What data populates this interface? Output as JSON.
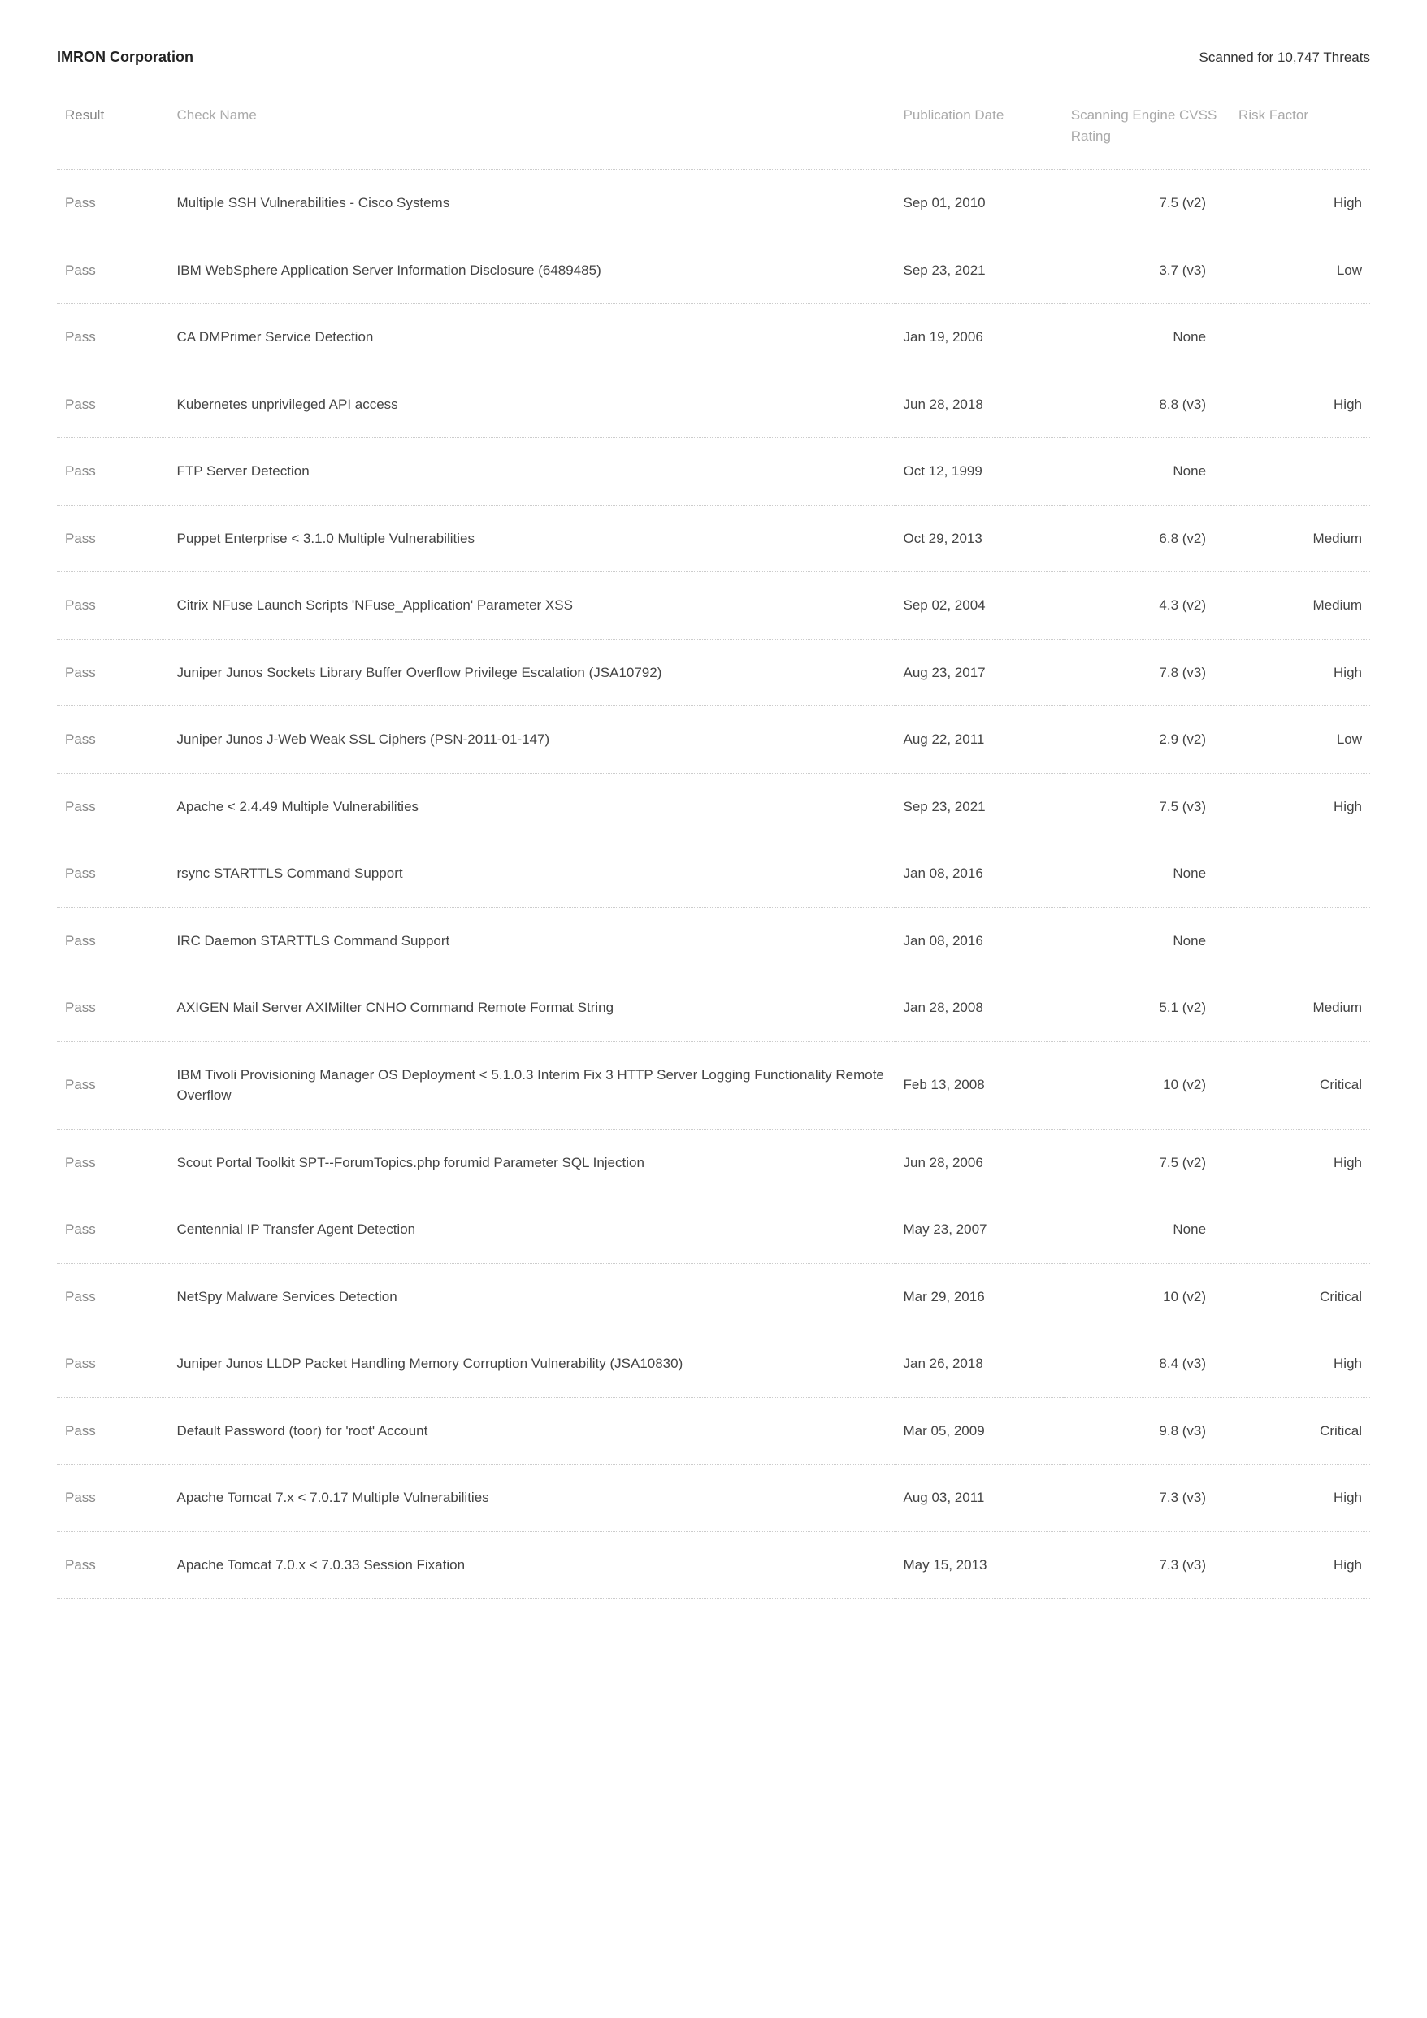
{
  "header": {
    "company": "IMRON Corporation",
    "scan_summary": "Scanned for 10,747 Threats"
  },
  "columns": {
    "result": "Result",
    "check_name": "Check Name",
    "pub_date": "Publication Date",
    "cvss": "Scanning Engine CVSS Rating",
    "risk": "Risk Factor"
  },
  "rows": [
    {
      "result": "Pass",
      "name": "Multiple SSH Vulnerabilities - Cisco Systems",
      "date": "Sep 01, 2010",
      "cvss": "7.5 (v2)",
      "risk": "High"
    },
    {
      "result": "Pass",
      "name": "IBM WebSphere Application Server Information Disclosure (6489485)",
      "date": "Sep 23, 2021",
      "cvss": "3.7 (v3)",
      "risk": "Low"
    },
    {
      "result": "Pass",
      "name": "CA DMPrimer Service Detection",
      "date": "Jan 19, 2006",
      "cvss": "None",
      "risk": ""
    },
    {
      "result": "Pass",
      "name": "Kubernetes unprivileged API access",
      "date": "Jun 28, 2018",
      "cvss": "8.8 (v3)",
      "risk": "High"
    },
    {
      "result": "Pass",
      "name": "FTP Server Detection",
      "date": "Oct 12, 1999",
      "cvss": "None",
      "risk": ""
    },
    {
      "result": "Pass",
      "name": "Puppet Enterprise < 3.1.0 Multiple Vulnerabilities",
      "date": "Oct 29, 2013",
      "cvss": "6.8 (v2)",
      "risk": "Medium"
    },
    {
      "result": "Pass",
      "name": "Citrix NFuse Launch Scripts 'NFuse_Application' Parameter XSS",
      "date": "Sep 02, 2004",
      "cvss": "4.3 (v2)",
      "risk": "Medium"
    },
    {
      "result": "Pass",
      "name": "Juniper Junos Sockets Library Buffer Overflow Privilege Escalation (JSA10792)",
      "date": "Aug 23, 2017",
      "cvss": "7.8 (v3)",
      "risk": "High"
    },
    {
      "result": "Pass",
      "name": "Juniper Junos J-Web Weak SSL Ciphers (PSN-2011-01-147)",
      "date": "Aug 22, 2011",
      "cvss": "2.9 (v2)",
      "risk": "Low"
    },
    {
      "result": "Pass",
      "name": "Apache < 2.4.49 Multiple Vulnerabilities",
      "date": "Sep 23, 2021",
      "cvss": "7.5 (v3)",
      "risk": "High"
    },
    {
      "result": "Pass",
      "name": "rsync STARTTLS Command Support",
      "date": "Jan 08, 2016",
      "cvss": "None",
      "risk": ""
    },
    {
      "result": "Pass",
      "name": "IRC Daemon STARTTLS Command Support",
      "date": "Jan 08, 2016",
      "cvss": "None",
      "risk": ""
    },
    {
      "result": "Pass",
      "name": "AXIGEN Mail Server AXIMilter CNHO Command Remote Format String",
      "date": "Jan 28, 2008",
      "cvss": "5.1 (v2)",
      "risk": "Medium"
    },
    {
      "result": "Pass",
      "name": "IBM Tivoli Provisioning Manager OS Deployment < 5.1.0.3 Interim Fix 3 HTTP Server Logging Functionality Remote Overflow",
      "date": "Feb 13, 2008",
      "cvss": "10 (v2)",
      "risk": "Critical"
    },
    {
      "result": "Pass",
      "name": "Scout Portal Toolkit SPT--ForumTopics.php forumid Parameter SQL Injection",
      "date": "Jun 28, 2006",
      "cvss": "7.5 (v2)",
      "risk": "High"
    },
    {
      "result": "Pass",
      "name": "Centennial IP Transfer Agent Detection",
      "date": "May 23, 2007",
      "cvss": "None",
      "risk": ""
    },
    {
      "result": "Pass",
      "name": "NetSpy Malware Services Detection",
      "date": "Mar 29, 2016",
      "cvss": "10 (v2)",
      "risk": "Critical"
    },
    {
      "result": "Pass",
      "name": "Juniper Junos LLDP Packet Handling Memory Corruption Vulnerability (JSA10830)",
      "date": "Jan 26, 2018",
      "cvss": "8.4 (v3)",
      "risk": "High"
    },
    {
      "result": "Pass",
      "name": "Default Password (toor) for 'root' Account",
      "date": "Mar 05, 2009",
      "cvss": "9.8 (v3)",
      "risk": "Critical"
    },
    {
      "result": "Pass",
      "name": "Apache Tomcat 7.x < 7.0.17 Multiple Vulnerabilities",
      "date": "Aug 03, 2011",
      "cvss": "7.3 (v3)",
      "risk": "High"
    },
    {
      "result": "Pass",
      "name": "Apache Tomcat 7.0.x < 7.0.33 Session Fixation",
      "date": "May 15, 2013",
      "cvss": "7.3 (v3)",
      "risk": "High"
    }
  ]
}
